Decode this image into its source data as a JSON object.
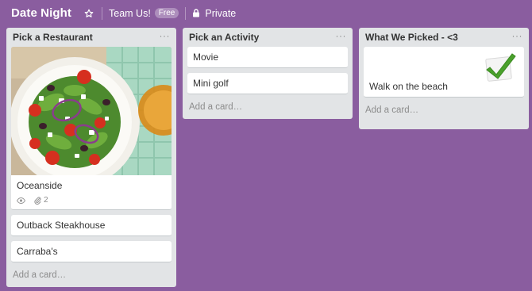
{
  "board": {
    "title": "Date Night",
    "team": "Team Us!",
    "team_badge": "Free",
    "visibility": "Private"
  },
  "lists": [
    {
      "title": "Pick a Restaurant",
      "menu": "···",
      "cards": [
        {
          "label": "Oceanside",
          "badge_attachments": "2",
          "cover": "salad-photo"
        },
        {
          "label": "Outback Steakhouse"
        },
        {
          "label": "Carraba's"
        }
      ],
      "add_card": "Add a card…"
    },
    {
      "title": "Pick an Activity",
      "menu": "···",
      "cards": [
        {
          "label": "Movie"
        },
        {
          "label": "Mini golf"
        }
      ],
      "add_card": "Add a card…"
    },
    {
      "title": "What We Picked - <3",
      "menu": "···",
      "cards": [
        {
          "label": "Walk on the beach",
          "sticker": "green-checkmark-icon"
        }
      ],
      "add_card": "Add a card…"
    }
  ],
  "colors": {
    "board_bg": "#8a5d9f",
    "list_bg": "#e2e4e6",
    "checkmark": "#4aa02c"
  }
}
